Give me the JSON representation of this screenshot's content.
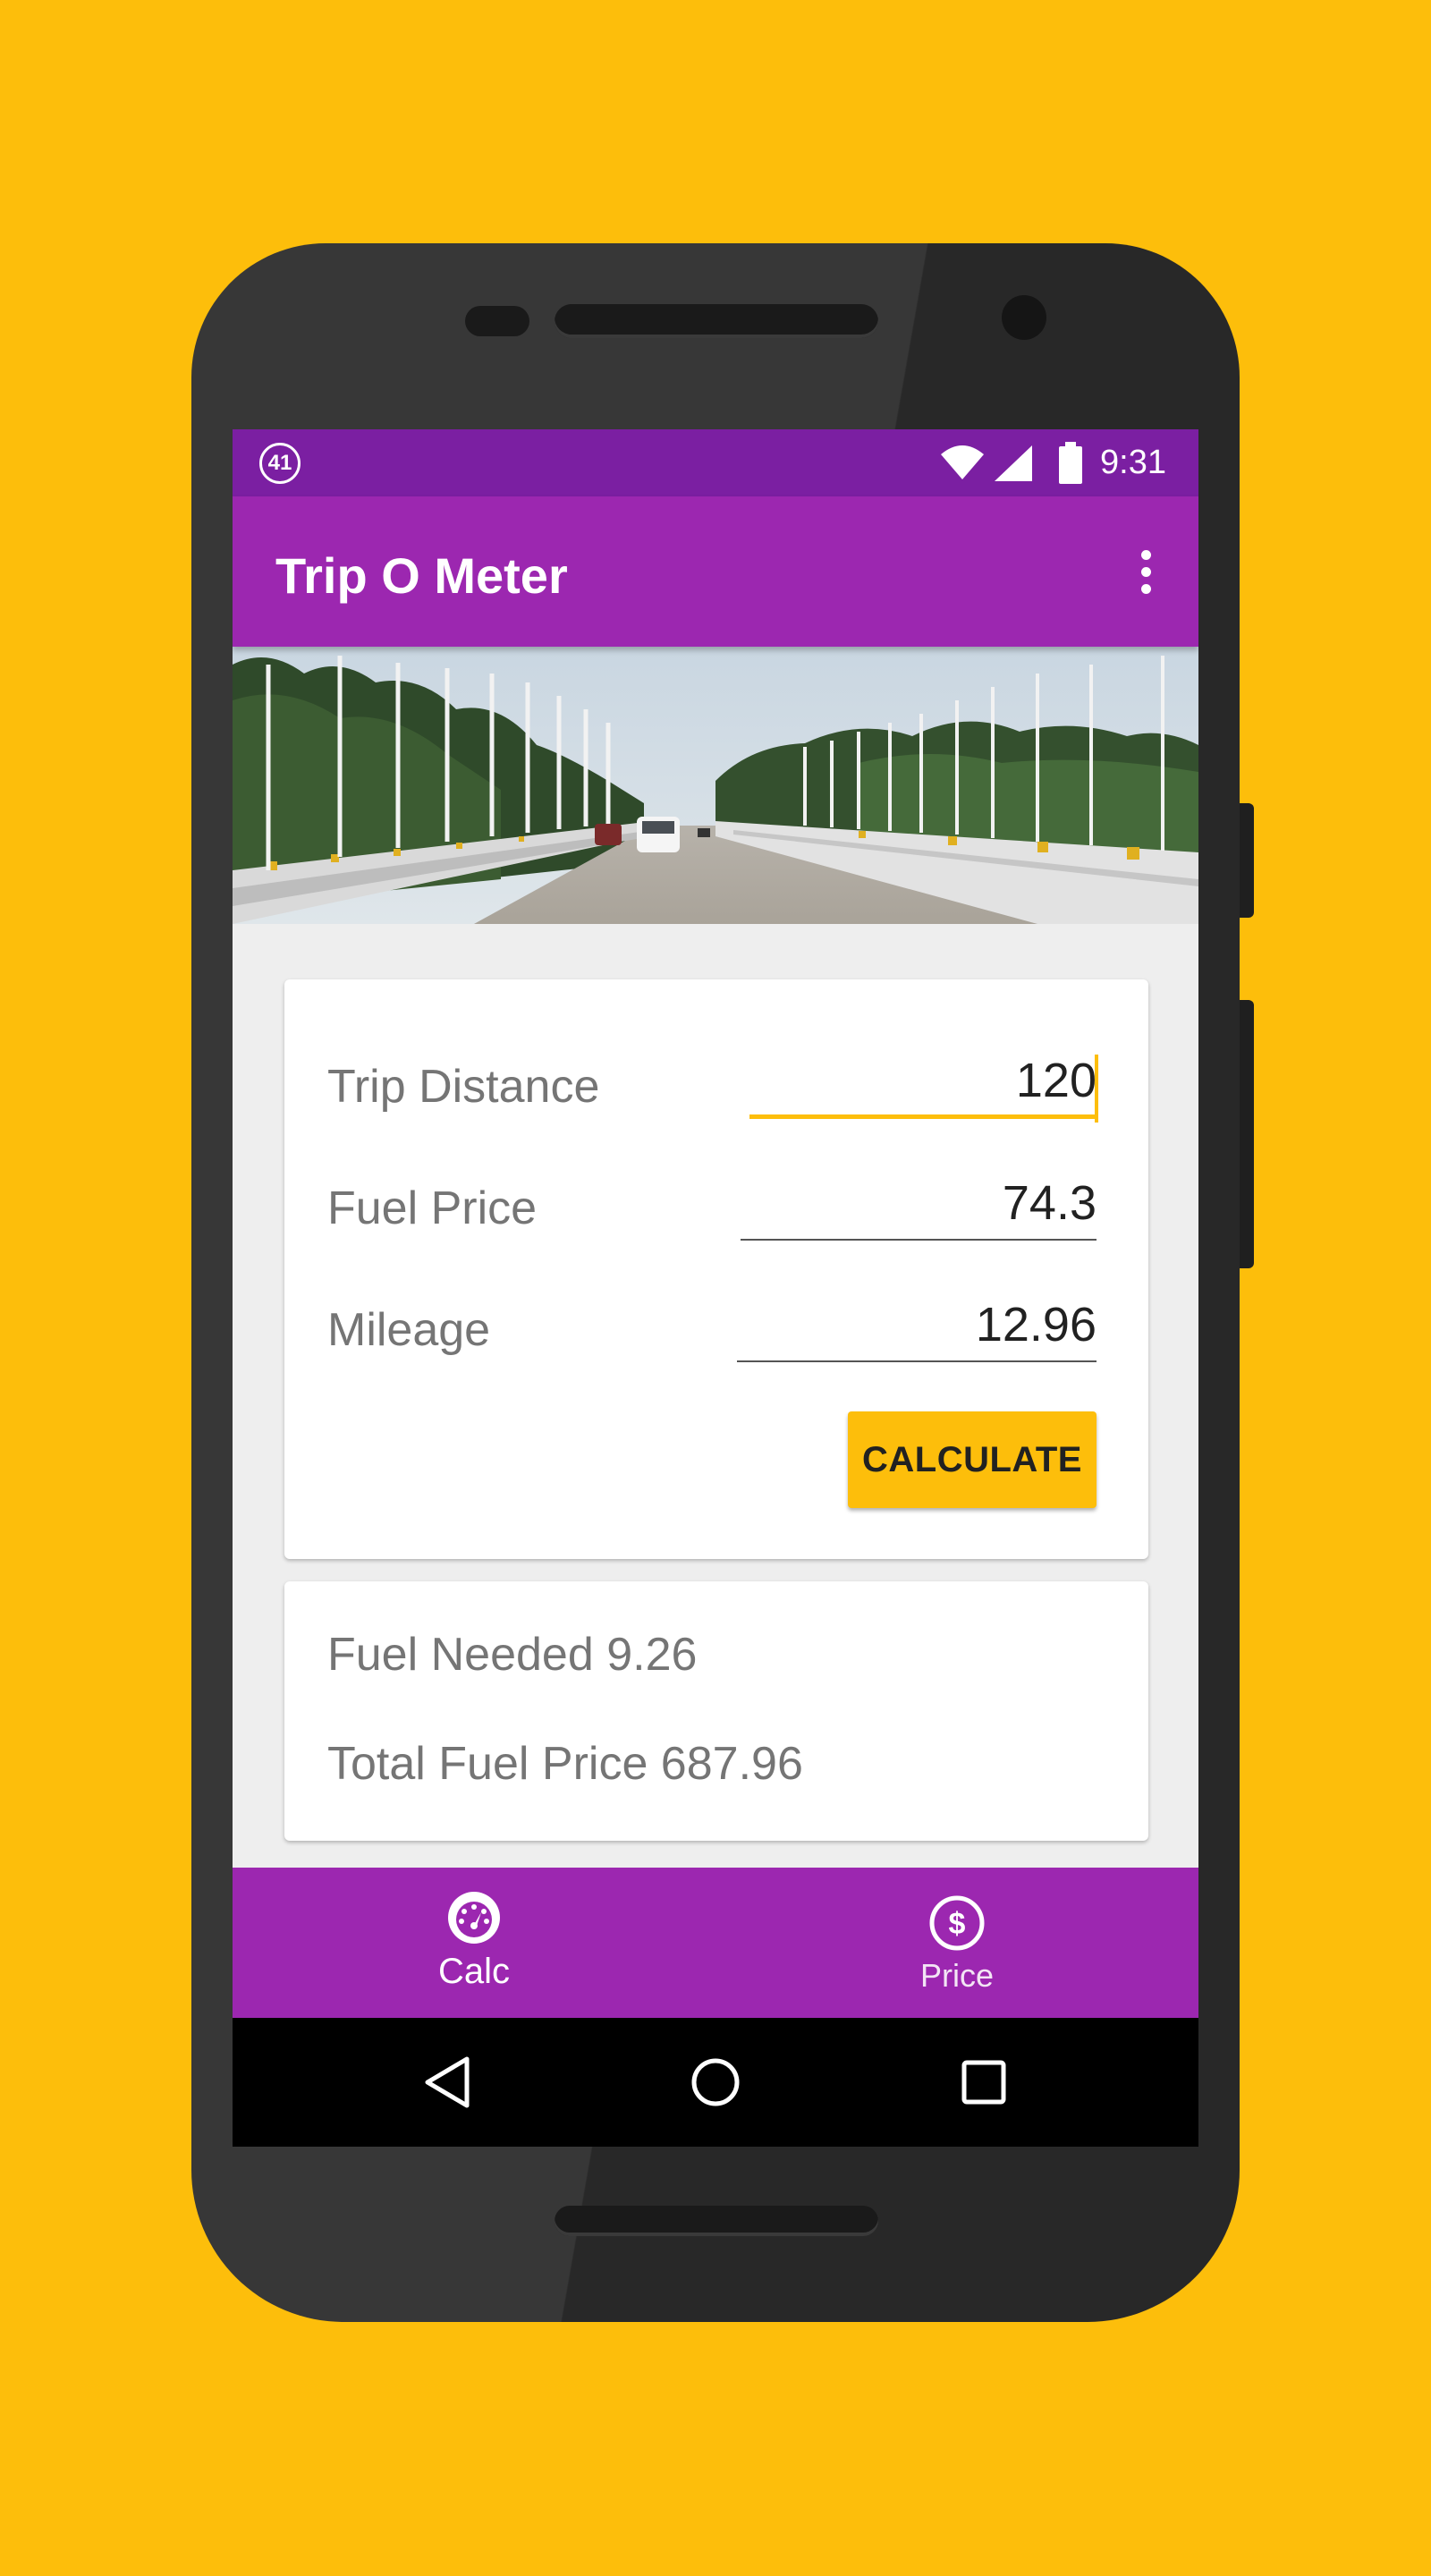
{
  "status_bar": {
    "notification_count": "41",
    "time": "9:31",
    "icons": [
      "wifi-icon",
      "signal-icon",
      "battery-icon"
    ]
  },
  "app_bar": {
    "title": "Trip O Meter",
    "menu_icon": "more-vert-icon"
  },
  "form": {
    "trip_distance": {
      "label": "Trip Distance",
      "value": "120"
    },
    "fuel_price": {
      "label": "Fuel Price",
      "value": "74.3"
    },
    "mileage": {
      "label": "Mileage",
      "value": "12.96"
    },
    "calculate_label": "CALCULATE"
  },
  "results": {
    "fuel_needed": "Fuel Needed 9.26",
    "total_fuel_price": "Total Fuel Price 687.96"
  },
  "bottom_nav": {
    "items": [
      {
        "label": "Calc",
        "icon": "speedometer-icon"
      },
      {
        "label": "Price",
        "icon": "dollar-circle-icon"
      }
    ]
  },
  "colors": {
    "background": "#FDBE0B",
    "primary": "#9C27B0",
    "primary_dark": "#7B1FA2",
    "accent": "#FDBE0B"
  },
  "system_nav": [
    "back-icon",
    "home-icon",
    "recents-icon"
  ]
}
